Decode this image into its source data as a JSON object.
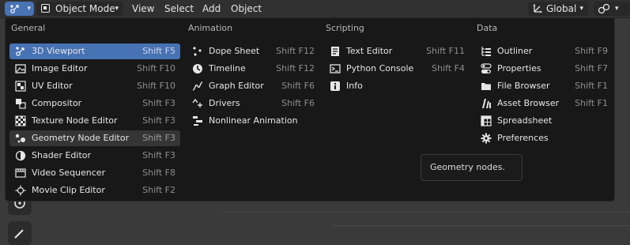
{
  "header": {
    "mode_label": "Object Mode",
    "menus": [
      "View",
      "Select",
      "Add",
      "Object"
    ],
    "orientation_label": "Global",
    "accent_color": "#4772b3"
  },
  "popup": {
    "columns": [
      {
        "title": "General",
        "items": [
          {
            "label": "3D Viewport",
            "shortcut": "Shift F5",
            "icon": "viewport-3d-icon",
            "state": "active"
          },
          {
            "label": "Image Editor",
            "shortcut": "Shift F10",
            "icon": "image-icon"
          },
          {
            "label": "UV Editor",
            "shortcut": "Shift F10",
            "icon": "uv-icon"
          },
          {
            "label": "Compositor",
            "shortcut": "Shift F3",
            "icon": "compositor-icon"
          },
          {
            "label": "Texture Node Editor",
            "shortcut": "Shift F3",
            "icon": "texture-icon"
          },
          {
            "label": "Geometry Node Editor",
            "shortcut": "Shift F3",
            "icon": "geometry-nodes-icon",
            "state": "hover"
          },
          {
            "label": "Shader Editor",
            "shortcut": "Shift F3",
            "icon": "shader-icon"
          },
          {
            "label": "Video Sequencer",
            "shortcut": "Shift F8",
            "icon": "sequencer-icon"
          },
          {
            "label": "Movie Clip Editor",
            "shortcut": "Shift F2",
            "icon": "movie-clip-icon"
          }
        ]
      },
      {
        "title": "Animation",
        "items": [
          {
            "label": "Dope Sheet",
            "shortcut": "Shift F12",
            "icon": "dope-sheet-icon"
          },
          {
            "label": "Timeline",
            "shortcut": "Shift F12",
            "icon": "timeline-icon"
          },
          {
            "label": "Graph Editor",
            "shortcut": "Shift F6",
            "icon": "graph-icon"
          },
          {
            "label": "Drivers",
            "shortcut": "Shift F6",
            "icon": "drivers-icon"
          },
          {
            "label": "Nonlinear Animation",
            "shortcut": "",
            "icon": "nla-icon"
          }
        ]
      },
      {
        "title": "Scripting",
        "items": [
          {
            "label": "Text Editor",
            "shortcut": "Shift F11",
            "icon": "text-icon"
          },
          {
            "label": "Python Console",
            "shortcut": "Shift F4",
            "icon": "console-icon"
          },
          {
            "label": "Info",
            "shortcut": "",
            "icon": "info-icon"
          }
        ]
      },
      {
        "title": "Data",
        "items": [
          {
            "label": "Outliner",
            "shortcut": "Shift F9",
            "icon": "outliner-icon"
          },
          {
            "label": "Properties",
            "shortcut": "Shift F7",
            "icon": "properties-icon"
          },
          {
            "label": "File Browser",
            "shortcut": "Shift F1",
            "icon": "file-browser-icon"
          },
          {
            "label": "Asset Browser",
            "shortcut": "Shift F1",
            "icon": "asset-browser-icon"
          },
          {
            "label": "Spreadsheet",
            "shortcut": "",
            "icon": "spreadsheet-icon"
          },
          {
            "label": "Preferences",
            "shortcut": "",
            "icon": "preferences-icon"
          }
        ]
      }
    ]
  },
  "tooltip": {
    "text": "Geometry nodes."
  }
}
